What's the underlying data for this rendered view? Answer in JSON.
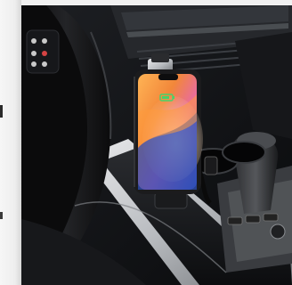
{
  "image": {
    "subject": "smartphone-in-cup-holder-mount",
    "scene": "car-interior",
    "colors": {
      "cabin": "#141518",
      "trim_silver": "#c7c9cc",
      "phone_frame": "#1b1b1d",
      "screen_orange": "#f2873a",
      "screen_blue": "#2e4fb8",
      "screen_pink": "#e86aa3",
      "charge_green": "#46d36a"
    }
  }
}
